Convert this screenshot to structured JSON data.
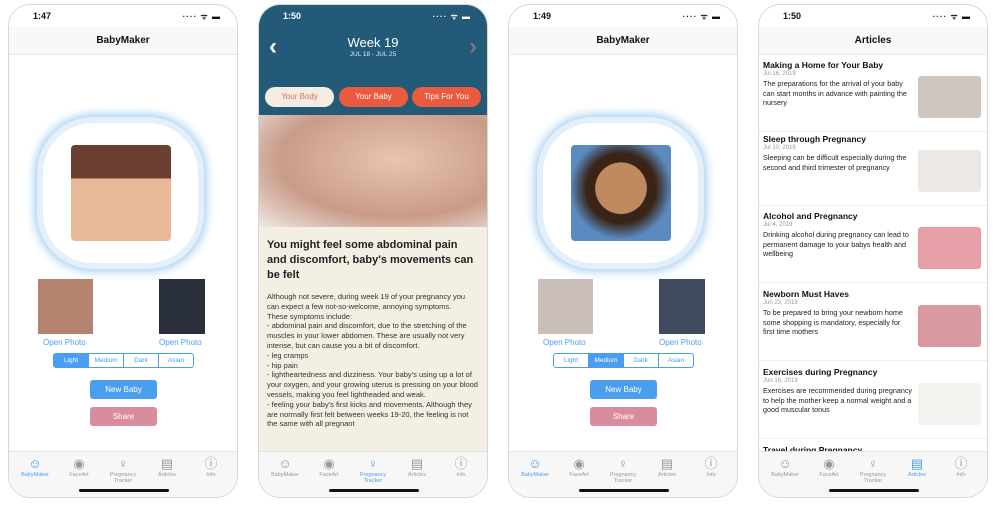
{
  "phones": [
    {
      "time": "1:47",
      "title": "BabyMaker",
      "open_left": "Open Photo",
      "open_right": "Open Photo",
      "skin": [
        "Light",
        "Medium",
        "Dark",
        "Asian"
      ],
      "skin_selected": 0,
      "new_baby": "New Baby",
      "share": "Share",
      "active_tab": 0
    },
    {
      "time": "1:50",
      "week": "Week 19",
      "range": "JUL 18 - JUL 25",
      "pills": [
        "Your Body",
        "Your Baby",
        "Tips For You"
      ],
      "heading": "You might feel some abdominal pain and discomfort, baby's movements can be felt",
      "body": "Although not severe, during week 19 of your pregnancy you can expect a few not-so-welcome, annoying symptoms.\nThese symptoms include:\n- abdominal pain and discomfort, due to the stretching of the muscles in your lower abdomen. These are usually not very intense, but can cause you a bit of discomfort.\n- leg cramps\n- hip pain\n- lightheartedness and dizziness. Your baby's using up a lot of your oxygen, and your growing uterus is pressing on your blood vessels, making you feel lightheaded and weak.\n- feeling your baby's first kicks and movements. Although they are normally first felt between weeks 19-20, the feeling is not the same with all pregnant",
      "active_tab": 2
    },
    {
      "time": "1:49",
      "title": "BabyMaker",
      "open_left": "Open Photo",
      "open_right": "Open Photo",
      "skin": [
        "Light",
        "Medium",
        "Dark",
        "Asian"
      ],
      "skin_selected": 1,
      "new_baby": "New Baby",
      "share": "Share",
      "active_tab": 0
    },
    {
      "time": "1:50",
      "title": "Articles",
      "articles": [
        {
          "title": "Making a Home for Your Baby",
          "date": "Jul 16, 2019",
          "summary": "The preparations for the arrival of your baby can start months in advance with painting the nursery"
        },
        {
          "title": "Sleep through Pregnancy",
          "date": "Jul 10, 2019",
          "summary": "Sleeping can be difficult especially during the second and third trimester of pregnancy"
        },
        {
          "title": "Alcohol and Pregnancy",
          "date": "Jul 4, 2019",
          "summary": "Drinking alcohol during pregnancy can lead to permanent damage to your babys health and wellbeing"
        },
        {
          "title": "Newborn Must Haves",
          "date": "Jun 23, 2019",
          "summary": "To be prepared to bring your newborn home some shopping is mandatory, especially for first time mothers"
        },
        {
          "title": "Exercises during Pregnancy",
          "date": "Jun 16, 2019",
          "summary": "Exercises are recommended during pregnancy to help the mother keep a normal weight and a good muscular tonus"
        },
        {
          "title": "Travel during Pregnancy",
          "date": "",
          "summary": ""
        }
      ],
      "active_tab": 3
    }
  ],
  "tabs": [
    {
      "label": "BabyMaker",
      "icon": "baby-face-icon"
    },
    {
      "label": "FaceArt",
      "icon": "eye-icon"
    },
    {
      "label": "Pregnancy Tracker",
      "icon": "pregnancy-icon"
    },
    {
      "label": "Articles",
      "icon": "articles-icon"
    },
    {
      "label": "Info",
      "icon": "info-icon"
    }
  ],
  "colors": {
    "accent": "#4a9ef0",
    "share": "#d98c9c",
    "header": "#235a78",
    "pill": "#ea5a3c",
    "pill_active": "#f5ece1",
    "article_bg": "#f3efe3"
  }
}
